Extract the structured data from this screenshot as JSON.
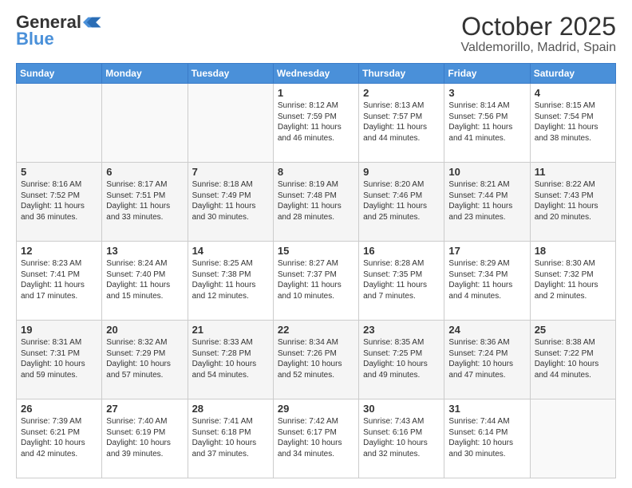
{
  "logo": {
    "general": "General",
    "blue": "Blue"
  },
  "header": {
    "month": "October 2025",
    "location": "Valdemorillo, Madrid, Spain"
  },
  "days_of_week": [
    "Sunday",
    "Monday",
    "Tuesday",
    "Wednesday",
    "Thursday",
    "Friday",
    "Saturday"
  ],
  "weeks": [
    [
      {
        "day": "",
        "info": ""
      },
      {
        "day": "",
        "info": ""
      },
      {
        "day": "",
        "info": ""
      },
      {
        "day": "1",
        "info": "Sunrise: 8:12 AM\nSunset: 7:59 PM\nDaylight: 11 hours\nand 46 minutes."
      },
      {
        "day": "2",
        "info": "Sunrise: 8:13 AM\nSunset: 7:57 PM\nDaylight: 11 hours\nand 44 minutes."
      },
      {
        "day": "3",
        "info": "Sunrise: 8:14 AM\nSunset: 7:56 PM\nDaylight: 11 hours\nand 41 minutes."
      },
      {
        "day": "4",
        "info": "Sunrise: 8:15 AM\nSunset: 7:54 PM\nDaylight: 11 hours\nand 38 minutes."
      }
    ],
    [
      {
        "day": "5",
        "info": "Sunrise: 8:16 AM\nSunset: 7:52 PM\nDaylight: 11 hours\nand 36 minutes."
      },
      {
        "day": "6",
        "info": "Sunrise: 8:17 AM\nSunset: 7:51 PM\nDaylight: 11 hours\nand 33 minutes."
      },
      {
        "day": "7",
        "info": "Sunrise: 8:18 AM\nSunset: 7:49 PM\nDaylight: 11 hours\nand 30 minutes."
      },
      {
        "day": "8",
        "info": "Sunrise: 8:19 AM\nSunset: 7:48 PM\nDaylight: 11 hours\nand 28 minutes."
      },
      {
        "day": "9",
        "info": "Sunrise: 8:20 AM\nSunset: 7:46 PM\nDaylight: 11 hours\nand 25 minutes."
      },
      {
        "day": "10",
        "info": "Sunrise: 8:21 AM\nSunset: 7:44 PM\nDaylight: 11 hours\nand 23 minutes."
      },
      {
        "day": "11",
        "info": "Sunrise: 8:22 AM\nSunset: 7:43 PM\nDaylight: 11 hours\nand 20 minutes."
      }
    ],
    [
      {
        "day": "12",
        "info": "Sunrise: 8:23 AM\nSunset: 7:41 PM\nDaylight: 11 hours\nand 17 minutes."
      },
      {
        "day": "13",
        "info": "Sunrise: 8:24 AM\nSunset: 7:40 PM\nDaylight: 11 hours\nand 15 minutes."
      },
      {
        "day": "14",
        "info": "Sunrise: 8:25 AM\nSunset: 7:38 PM\nDaylight: 11 hours\nand 12 minutes."
      },
      {
        "day": "15",
        "info": "Sunrise: 8:27 AM\nSunset: 7:37 PM\nDaylight: 11 hours\nand 10 minutes."
      },
      {
        "day": "16",
        "info": "Sunrise: 8:28 AM\nSunset: 7:35 PM\nDaylight: 11 hours\nand 7 minutes."
      },
      {
        "day": "17",
        "info": "Sunrise: 8:29 AM\nSunset: 7:34 PM\nDaylight: 11 hours\nand 4 minutes."
      },
      {
        "day": "18",
        "info": "Sunrise: 8:30 AM\nSunset: 7:32 PM\nDaylight: 11 hours\nand 2 minutes."
      }
    ],
    [
      {
        "day": "19",
        "info": "Sunrise: 8:31 AM\nSunset: 7:31 PM\nDaylight: 10 hours\nand 59 minutes."
      },
      {
        "day": "20",
        "info": "Sunrise: 8:32 AM\nSunset: 7:29 PM\nDaylight: 10 hours\nand 57 minutes."
      },
      {
        "day": "21",
        "info": "Sunrise: 8:33 AM\nSunset: 7:28 PM\nDaylight: 10 hours\nand 54 minutes."
      },
      {
        "day": "22",
        "info": "Sunrise: 8:34 AM\nSunset: 7:26 PM\nDaylight: 10 hours\nand 52 minutes."
      },
      {
        "day": "23",
        "info": "Sunrise: 8:35 AM\nSunset: 7:25 PM\nDaylight: 10 hours\nand 49 minutes."
      },
      {
        "day": "24",
        "info": "Sunrise: 8:36 AM\nSunset: 7:24 PM\nDaylight: 10 hours\nand 47 minutes."
      },
      {
        "day": "25",
        "info": "Sunrise: 8:38 AM\nSunset: 7:22 PM\nDaylight: 10 hours\nand 44 minutes."
      }
    ],
    [
      {
        "day": "26",
        "info": "Sunrise: 7:39 AM\nSunset: 6:21 PM\nDaylight: 10 hours\nand 42 minutes."
      },
      {
        "day": "27",
        "info": "Sunrise: 7:40 AM\nSunset: 6:19 PM\nDaylight: 10 hours\nand 39 minutes."
      },
      {
        "day": "28",
        "info": "Sunrise: 7:41 AM\nSunset: 6:18 PM\nDaylight: 10 hours\nand 37 minutes."
      },
      {
        "day": "29",
        "info": "Sunrise: 7:42 AM\nSunset: 6:17 PM\nDaylight: 10 hours\nand 34 minutes."
      },
      {
        "day": "30",
        "info": "Sunrise: 7:43 AM\nSunset: 6:16 PM\nDaylight: 10 hours\nand 32 minutes."
      },
      {
        "day": "31",
        "info": "Sunrise: 7:44 AM\nSunset: 6:14 PM\nDaylight: 10 hours\nand 30 minutes."
      },
      {
        "day": "",
        "info": ""
      }
    ]
  ]
}
